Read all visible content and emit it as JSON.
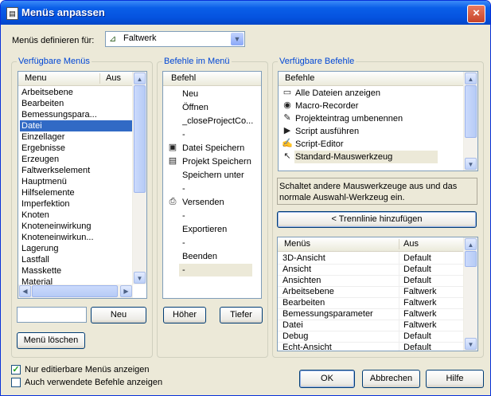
{
  "window": {
    "title": "Menüs anpassen",
    "close": "×"
  },
  "define": {
    "label": "Menüs definieren für:",
    "value": "Faltwerk"
  },
  "groups": {
    "available_menus": "Verfügbare Menüs",
    "commands_in_menu": "Befehle im Menü",
    "available_commands": "Verfügbare Befehle"
  },
  "menus_list": {
    "col1": "Menu",
    "col2": "Aus",
    "items": [
      "Arbeitsebene",
      "Bearbeiten",
      "Bemessungspara...",
      "Datei",
      "Einzellager",
      "Ergebnisse",
      "Erzeugen",
      "Faltwerkselement",
      "Hauptmenü",
      "Hilfselemente",
      "Imperfektion",
      "Knoten",
      "Knoteneinwirkung",
      "Knoteneinwirkun...",
      "Lagerung",
      "Lastfall",
      "Masskette",
      "Material"
    ]
  },
  "commands_list": {
    "col1": "Befehl",
    "items": [
      {
        "text": "Neu",
        "icon": ""
      },
      {
        "text": "Öffnen",
        "icon": ""
      },
      {
        "text": "_closeProjectCo...",
        "icon": ""
      },
      {
        "text": "-",
        "icon": ""
      },
      {
        "text": "Datei Speichern",
        "icon": "save-icon"
      },
      {
        "text": "Projekt Speichern",
        "icon": "save-all-icon"
      },
      {
        "text": "Speichern unter",
        "icon": ""
      },
      {
        "text": "-",
        "icon": ""
      },
      {
        "text": "Versenden",
        "icon": "print-icon"
      },
      {
        "text": "-",
        "icon": ""
      },
      {
        "text": "Exportieren",
        "icon": ""
      },
      {
        "text": "-",
        "icon": ""
      },
      {
        "text": "Beenden",
        "icon": ""
      },
      {
        "text": "-",
        "icon": ""
      }
    ]
  },
  "available_cmds": {
    "col1": "Befehle",
    "items": [
      {
        "text": "Alle Dateien anzeigen",
        "icon": "document-icon"
      },
      {
        "text": "Macro-Recorder",
        "icon": "recorder-icon"
      },
      {
        "text": "Projekteintrag umbenennen",
        "icon": "rename-icon"
      },
      {
        "text": "Script ausführen",
        "icon": "script-run-icon"
      },
      {
        "text": "Script-Editor",
        "icon": "script-editor-icon"
      },
      {
        "text": "Standard-Mauswerkzeug",
        "icon": "cursor-icon"
      }
    ]
  },
  "description": "Schaltet andere Mauswerkzeuge aus und das normale Auswahl-Werkzeug ein.",
  "add_separator": "< Trennlinie hinzufügen",
  "menus_table": {
    "col1": "Menüs",
    "col2": "Aus",
    "rows": [
      {
        "menu": "3D-Ansicht",
        "aus": "Default"
      },
      {
        "menu": "Ansicht",
        "aus": "Default"
      },
      {
        "menu": "Ansichten",
        "aus": "Default"
      },
      {
        "menu": "Arbeitsebene",
        "aus": "Faltwerk"
      },
      {
        "menu": "Bearbeiten",
        "aus": "Faltwerk"
      },
      {
        "menu": "Bemessungsparameter",
        "aus": "Faltwerk"
      },
      {
        "menu": "Datei",
        "aus": "Faltwerk"
      },
      {
        "menu": "Debug",
        "aus": "Default"
      },
      {
        "menu": "Echt-Ansicht",
        "aus": "Default"
      }
    ]
  },
  "buttons": {
    "neu": "Neu",
    "menu_loeschen": "Menü löschen",
    "hoeher": "Höher",
    "tiefer": "Tiefer",
    "ok": "OK",
    "abbrechen": "Abbrechen",
    "hilfe": "Hilfe"
  },
  "checkboxes": {
    "only_editable": "Nur editierbare Menüs anzeigen",
    "show_used": "Auch verwendete Befehle anzeigen"
  },
  "selected_menu_index": 3
}
